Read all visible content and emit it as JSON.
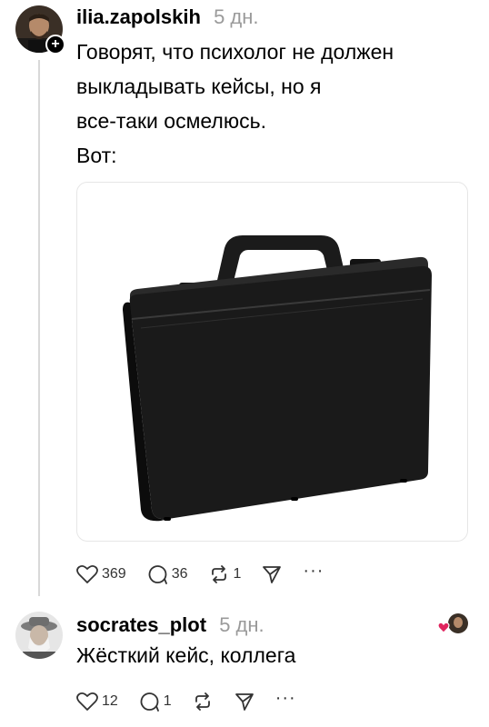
{
  "post": {
    "username": "ilia.zapolskih",
    "time": "5 дн.",
    "lines": [
      "Говорят, что психолог не должен",
      "выкладывать кейсы, но я",
      "все-таки осмелюсь.",
      "Вот:"
    ],
    "follow_symbol": "+",
    "stats": {
      "likes": "369",
      "comments": "36",
      "reposts": "1"
    },
    "more": "···"
  },
  "reply": {
    "username": "socrates_plot",
    "time": "5 дн.",
    "text": "Жёсткий кейс, коллега",
    "stats": {
      "likes": "12",
      "comments": "1"
    },
    "more": "···"
  },
  "colors": {
    "accent_like": "#e0245e",
    "muted": "#9a9a9a",
    "thread_line": "#d9d9d9"
  },
  "icons": [
    "heart-icon",
    "comment-icon",
    "repost-icon",
    "share-icon",
    "more-icon",
    "plus-icon"
  ]
}
